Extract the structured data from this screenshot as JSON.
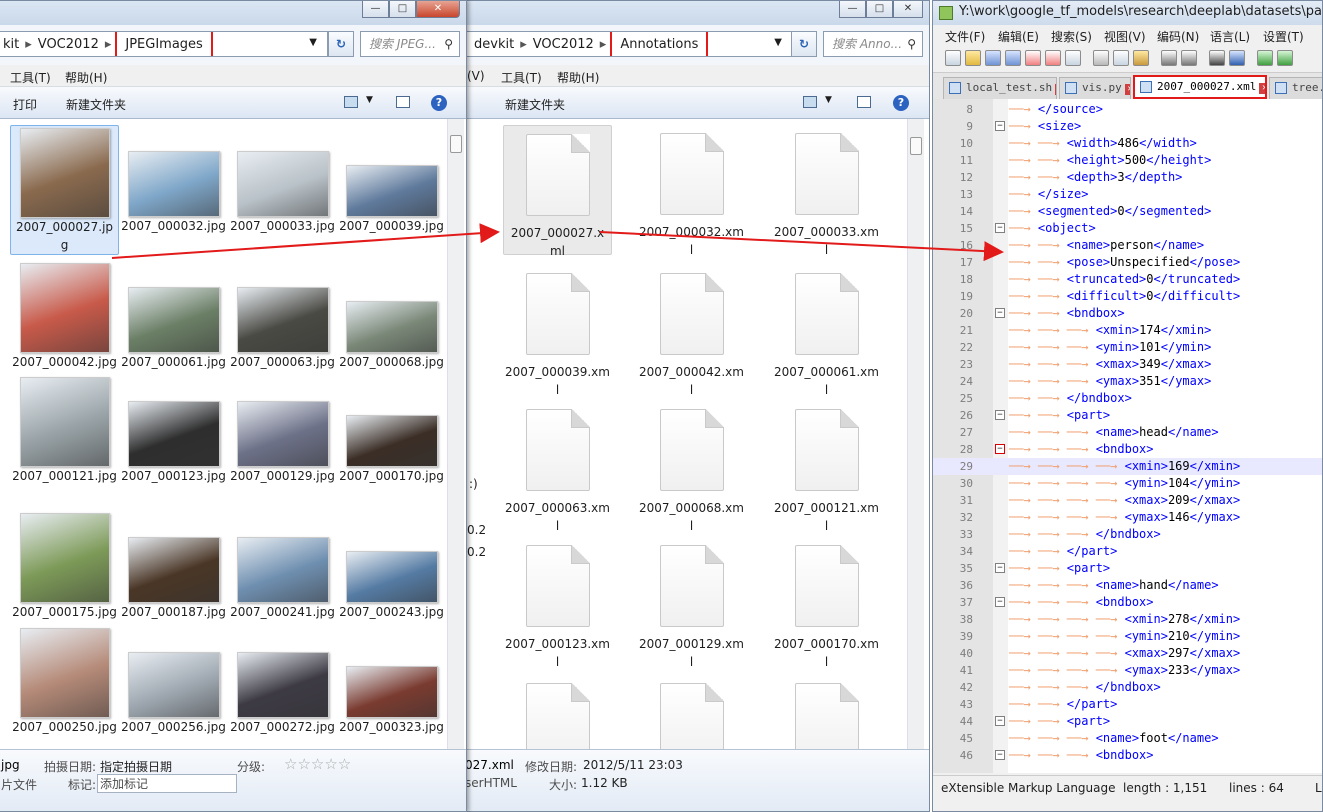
{
  "explorer_left": {
    "address_parts": [
      "kit",
      "VOC2012",
      "JPEGImages"
    ],
    "search_placeholder": "搜索 JPEG...",
    "menu": [
      "工具(T)",
      "帮助(H)"
    ],
    "commands": [
      "打印",
      "新建文件夹"
    ],
    "files": [
      {
        "name": "2007_000027.jpg",
        "color": "#8a6a4e",
        "selected": true
      },
      {
        "name": "2007_000032.jpg",
        "color": "#7fa7c9"
      },
      {
        "name": "2007_000033.jpg",
        "color": "#b9c2c8"
      },
      {
        "name": "2007_000039.jpg",
        "color": "#5f7a9c"
      },
      {
        "name": "2007_000042.jpg",
        "color": "#c85a4a"
      },
      {
        "name": "2007_000061.jpg",
        "color": "#6b7f66"
      },
      {
        "name": "2007_000063.jpg",
        "color": "#4a4a44"
      },
      {
        "name": "2007_000068.jpg",
        "color": "#7a8878"
      },
      {
        "name": "2007_000121.jpg",
        "color": "#9aa4a8"
      },
      {
        "name": "2007_000123.jpg",
        "color": "#2e2e2e"
      },
      {
        "name": "2007_000129.jpg",
        "color": "#6d7188"
      },
      {
        "name": "2007_000170.jpg",
        "color": "#3b2e26"
      },
      {
        "name": "2007_000175.jpg",
        "color": "#7d9a58"
      },
      {
        "name": "2007_000187.jpg",
        "color": "#4a3626"
      },
      {
        "name": "2007_000241.jpg",
        "color": "#6f8fb0"
      },
      {
        "name": "2007_000243.jpg",
        "color": "#557ba3"
      },
      {
        "name": "2007_000250.jpg",
        "color": "#b58a78"
      },
      {
        "name": "2007_000256.jpg",
        "color": "#a0a9b2"
      },
      {
        "name": "2007_000272.jpg",
        "color": "#3d3a44"
      },
      {
        "name": "2007_000323.jpg",
        "color": "#7a3b30"
      }
    ],
    "detail": {
      "name": "jpg",
      "type": "片文件",
      "date_label": "拍摄日期:",
      "date_value": "指定拍摄日期",
      "rating_label": "分级:",
      "stars": "☆☆☆☆☆",
      "tag_label": "标记:",
      "tag_value": "添加标记"
    }
  },
  "explorer_right": {
    "address_parts": [
      "devkit",
      "VOC2012",
      "Annotations"
    ],
    "search_placeholder": "搜索 Anno...",
    "menu": [
      "(V)",
      "工具(T)",
      "帮助(H)"
    ],
    "commands": [
      "新建文件夹"
    ],
    "files": [
      "2007_000027.xml",
      "2007_000032.xml",
      "2007_000033.xml",
      "2007_000039.xml",
      "2007_000042.xml",
      "2007_000061.xml",
      "2007_000063.xml",
      "2007_000068.xml",
      "2007_000121.xml",
      "2007_000123.xml",
      "2007_000129.xml",
      "2007_000170.xml",
      "",
      "",
      ""
    ],
    "side_fragments": [
      ":)",
      "0.2",
      "0.2"
    ],
    "detail": {
      "name": "027.xml",
      "type": "serHTML",
      "modified_label": "修改日期:",
      "modified_value": "2012/5/11 23:03",
      "size_label": "大小:",
      "size_value": "1.12 KB"
    }
  },
  "notepad": {
    "title": "Y:\\work\\google_tf_models\\research\\deeplab\\datasets\\pascal_v",
    "menu": [
      "文件(F)",
      "编辑(E)",
      "搜索(S)",
      "视图(V)",
      "编码(N)",
      "语言(L)",
      "设置(T)"
    ],
    "tabs": [
      {
        "label": "local_test.sh",
        "active": false
      },
      {
        "label": "vis.py",
        "active": false
      },
      {
        "label": "2007_000027.xml",
        "active": true
      },
      {
        "label": "tree.t",
        "active": false
      }
    ],
    "lines": [
      {
        "n": "8",
        "fold": "",
        "indent": 1,
        "text": "</source>"
      },
      {
        "n": "9",
        "fold": "-",
        "indent": 1,
        "text": "<size>"
      },
      {
        "n": "10",
        "fold": "",
        "indent": 2,
        "text": "<width>486</width>"
      },
      {
        "n": "11",
        "fold": "",
        "indent": 2,
        "text": "<height>500</height>"
      },
      {
        "n": "12",
        "fold": "",
        "indent": 2,
        "text": "<depth>3</depth>"
      },
      {
        "n": "13",
        "fold": "",
        "indent": 1,
        "text": "</size>"
      },
      {
        "n": "14",
        "fold": "",
        "indent": 1,
        "text": "<segmented>0</segmented>"
      },
      {
        "n": "15",
        "fold": "-",
        "indent": 1,
        "text": "<object>"
      },
      {
        "n": "16",
        "fold": "",
        "indent": 2,
        "text": "<name>person</name>"
      },
      {
        "n": "17",
        "fold": "",
        "indent": 2,
        "text": "<pose>Unspecified</pose>"
      },
      {
        "n": "18",
        "fold": "",
        "indent": 2,
        "text": "<truncated>0</truncated>"
      },
      {
        "n": "19",
        "fold": "",
        "indent": 2,
        "text": "<difficult>0</difficult>"
      },
      {
        "n": "20",
        "fold": "-",
        "indent": 2,
        "text": "<bndbox>"
      },
      {
        "n": "21",
        "fold": "",
        "indent": 3,
        "text": "<xmin>174</xmin>"
      },
      {
        "n": "22",
        "fold": "",
        "indent": 3,
        "text": "<ymin>101</ymin>"
      },
      {
        "n": "23",
        "fold": "",
        "indent": 3,
        "text": "<xmax>349</xmax>"
      },
      {
        "n": "24",
        "fold": "",
        "indent": 3,
        "text": "<ymax>351</ymax>"
      },
      {
        "n": "25",
        "fold": "",
        "indent": 2,
        "text": "</bndbox>"
      },
      {
        "n": "26",
        "fold": "-",
        "indent": 2,
        "text": "<part>"
      },
      {
        "n": "27",
        "fold": "",
        "indent": 3,
        "text": "<name>head</name>"
      },
      {
        "n": "28",
        "fold": "-r",
        "indent": 3,
        "text": "<bndbox>"
      },
      {
        "n": "29",
        "fold": "",
        "indent": 4,
        "text": "<xmin>169</xmin>",
        "current": true
      },
      {
        "n": "30",
        "fold": "",
        "indent": 4,
        "text": "<ymin>104</ymin>"
      },
      {
        "n": "31",
        "fold": "",
        "indent": 4,
        "text": "<xmax>209</xmax>"
      },
      {
        "n": "32",
        "fold": "",
        "indent": 4,
        "text": "<ymax>146</ymax>"
      },
      {
        "n": "33",
        "fold": "",
        "indent": 3,
        "text": "</bndbox>"
      },
      {
        "n": "34",
        "fold": "",
        "indent": 2,
        "text": "</part>"
      },
      {
        "n": "35",
        "fold": "-",
        "indent": 2,
        "text": "<part>"
      },
      {
        "n": "36",
        "fold": "",
        "indent": 3,
        "text": "<name>hand</name>"
      },
      {
        "n": "37",
        "fold": "-",
        "indent": 3,
        "text": "<bndbox>"
      },
      {
        "n": "38",
        "fold": "",
        "indent": 4,
        "text": "<xmin>278</xmin>"
      },
      {
        "n": "39",
        "fold": "",
        "indent": 4,
        "text": "<ymin>210</ymin>"
      },
      {
        "n": "40",
        "fold": "",
        "indent": 4,
        "text": "<xmax>297</xmax>"
      },
      {
        "n": "41",
        "fold": "",
        "indent": 4,
        "text": "<ymax>233</ymax>"
      },
      {
        "n": "42",
        "fold": "",
        "indent": 3,
        "text": "</bndbox>"
      },
      {
        "n": "43",
        "fold": "",
        "indent": 2,
        "text": "</part>"
      },
      {
        "n": "44",
        "fold": "-",
        "indent": 2,
        "text": "<part>"
      },
      {
        "n": "45",
        "fold": "",
        "indent": 3,
        "text": "<name>foot</name>"
      },
      {
        "n": "46",
        "fold": "-",
        "indent": 3,
        "text": "<bndbox>"
      }
    ],
    "status": {
      "language": "eXtensible Markup Language",
      "length": "length : 1,151",
      "lines": "lines : 64",
      "extra": "Ln"
    }
  }
}
